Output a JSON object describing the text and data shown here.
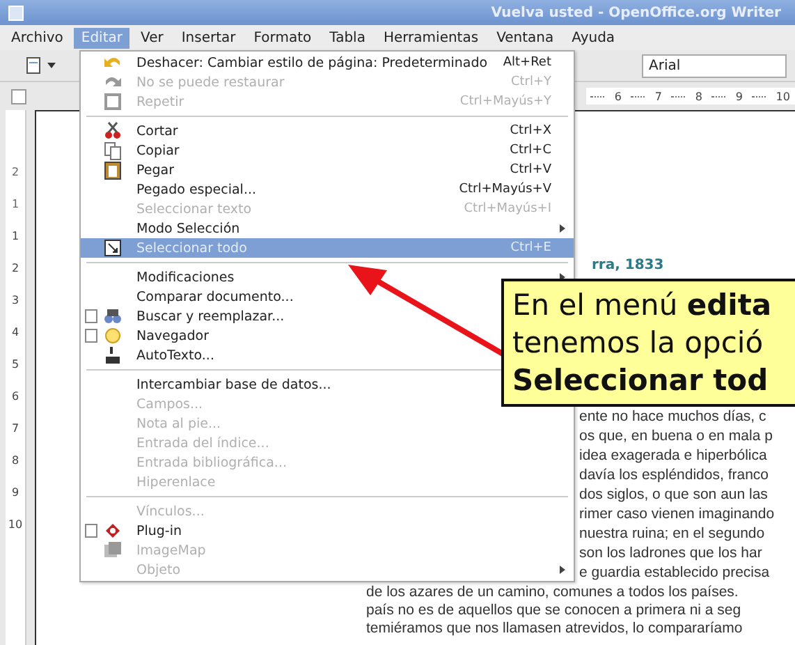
{
  "window": {
    "title": "Vuelva usted - OpenOffice.org Writer"
  },
  "menubar": [
    {
      "label": "Archivo",
      "selected": false
    },
    {
      "label": "Editar",
      "selected": true
    },
    {
      "label": "Ver",
      "selected": false
    },
    {
      "label": "Insertar",
      "selected": false
    },
    {
      "label": "Formato",
      "selected": false
    },
    {
      "label": "Tabla",
      "selected": false
    },
    {
      "label": "Herramientas",
      "selected": false
    },
    {
      "label": "Ventana",
      "selected": false
    },
    {
      "label": "Ayuda",
      "selected": false
    }
  ],
  "toolbar": {
    "font_name": "Arial"
  },
  "ruler": {
    "marks": [
      "6",
      "7",
      "8",
      "9",
      "10"
    ],
    "vertical_marks": [
      "2",
      "1",
      "1",
      "2",
      "3",
      "4",
      "5",
      "6",
      "7",
      "8",
      "9",
      "10"
    ]
  },
  "edit_menu": [
    {
      "kind": "item",
      "label": "Deshacer: Cambiar estilo de página: Predeterminado",
      "shortcut": "Alt+Ret",
      "disabled": false,
      "selected": false
    },
    {
      "kind": "item",
      "label": "No se puede restaurar",
      "shortcut": "Ctrl+Y",
      "disabled": true,
      "selected": false
    },
    {
      "kind": "item",
      "label": "Repetir",
      "shortcut": "Ctrl+Mayús+Y",
      "disabled": true,
      "selected": false
    },
    {
      "kind": "separator"
    },
    {
      "kind": "item",
      "label": "Cortar",
      "shortcut": "Ctrl+X",
      "disabled": false,
      "selected": false
    },
    {
      "kind": "item",
      "label": "Copiar",
      "shortcut": "Ctrl+C",
      "disabled": false,
      "selected": false
    },
    {
      "kind": "item",
      "label": "Pegar",
      "shortcut": "Ctrl+V",
      "disabled": false,
      "selected": false
    },
    {
      "kind": "item",
      "label": "Pegado especial...",
      "shortcut": "Ctrl+Mayús+V",
      "disabled": false,
      "selected": false
    },
    {
      "kind": "item",
      "label": "Seleccionar texto",
      "shortcut": "Ctrl+Mayús+I",
      "disabled": true,
      "selected": false
    },
    {
      "kind": "item",
      "label": "Modo Selección",
      "disabled": false,
      "selected": false,
      "submenu": true
    },
    {
      "kind": "item",
      "label": "Seleccionar todo",
      "shortcut": "Ctrl+E",
      "disabled": false,
      "selected": true
    },
    {
      "kind": "separator"
    },
    {
      "kind": "item",
      "label": "Modificaciones",
      "disabled": false,
      "selected": false,
      "submenu": true
    },
    {
      "kind": "item",
      "label": "Comparar documento...",
      "disabled": false,
      "selected": false
    },
    {
      "kind": "item",
      "label": "Buscar y reemplazar...",
      "disabled": false,
      "selected": false,
      "checked": false
    },
    {
      "kind": "item",
      "label": "Navegador",
      "disabled": false,
      "selected": false,
      "checked": false
    },
    {
      "kind": "item",
      "label": "AutoTexto...",
      "disabled": false,
      "selected": false
    },
    {
      "kind": "separator"
    },
    {
      "kind": "item",
      "label": "Intercambiar base de datos...",
      "disabled": false,
      "selected": false
    },
    {
      "kind": "item",
      "label": "Campos...",
      "disabled": true,
      "selected": false
    },
    {
      "kind": "item",
      "label": "Nota al pie...",
      "disabled": true,
      "selected": false
    },
    {
      "kind": "item",
      "label": "Entrada del índice...",
      "disabled": true,
      "selected": false
    },
    {
      "kind": "item",
      "label": "Entrada bibliográfica...",
      "disabled": true,
      "selected": false
    },
    {
      "kind": "item",
      "label": "Hiperenlace",
      "disabled": true,
      "selected": false
    },
    {
      "kind": "separator"
    },
    {
      "kind": "item",
      "label": "Vínculos...",
      "disabled": true,
      "selected": false
    },
    {
      "kind": "item",
      "label": "Plug-in",
      "disabled": false,
      "selected": false,
      "checked": false
    },
    {
      "kind": "item",
      "label": "ImageMap",
      "disabled": true,
      "selected": false
    },
    {
      "kind": "item",
      "label": "Objeto",
      "disabled": true,
      "selected": false,
      "submenu": true
    }
  ],
  "document": {
    "heading": "rra, 1833",
    "lines_beside_menu": [
      "ente no hace muchos días, c",
      "os que, en buena o en mala p",
      "idea exagerada e hiperbólica",
      "davía los espléndidos, franco",
      "dos siglos, o que son aun las",
      "rimer caso vienen imaginando",
      "nuestra ruina; en el segundo",
      "son los ladrones que los har",
      "e guardia establecido precisa"
    ],
    "lines_below_menu": [
      "de los azares de un camino, comunes a todos los países.",
      "país no es de aquellos que se conocen a primera ni a seg",
      "temiéramos que nos llamasen atrevidos, lo compararíamo"
    ]
  },
  "callout": {
    "lines": [
      "En el menú **edita**",
      "tenemos la opció",
      "**Seleccionar tod**"
    ]
  }
}
